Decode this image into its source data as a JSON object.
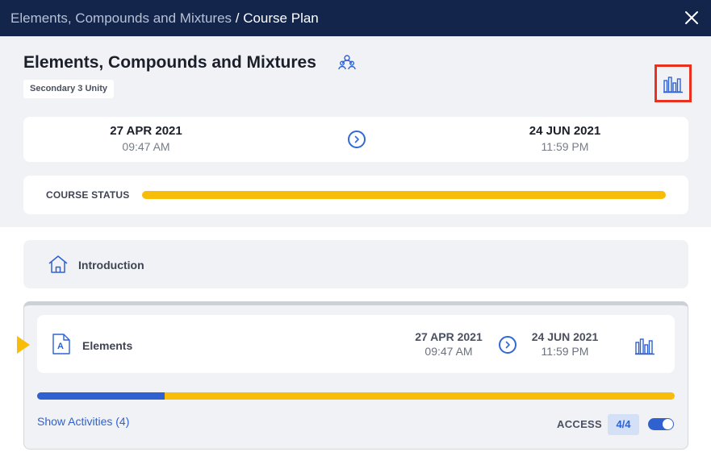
{
  "breadcrumb": {
    "parent": "Elements, Compounds and Mixtures",
    "separator": " / ",
    "current": "Course Plan"
  },
  "course": {
    "title": "Elements, Compounds and Mixtures",
    "class_tag": "Secondary 3 Unity",
    "start_date": "27 APR 2021",
    "start_time": "09:47 AM",
    "end_date": "24 JUN 2021",
    "end_time": "11:59 PM",
    "status_label": "COURSE STATUS",
    "status_progress": 1.0
  },
  "intro": {
    "label": "Introduction"
  },
  "module": {
    "label": "Elements",
    "icon_letter": "A",
    "start_date": "27 APR 2021",
    "start_time": "09:47 AM",
    "end_date": "24 JUN 2021",
    "end_time": "11:59 PM",
    "progress_fraction": 0.2,
    "show_activities": "Show Activities (4)",
    "access_label": "ACCESS",
    "access_value": "4/4",
    "access_enabled": true
  },
  "colors": {
    "header_bg": "#13254a",
    "accent_blue": "#2f62d0",
    "accent_yellow": "#f8bd08",
    "highlight_red": "#e8321f"
  },
  "icons": [
    "close-icon",
    "group-icon",
    "bar-chart-icon",
    "chevron-right-icon",
    "home-icon",
    "document-icon"
  ]
}
